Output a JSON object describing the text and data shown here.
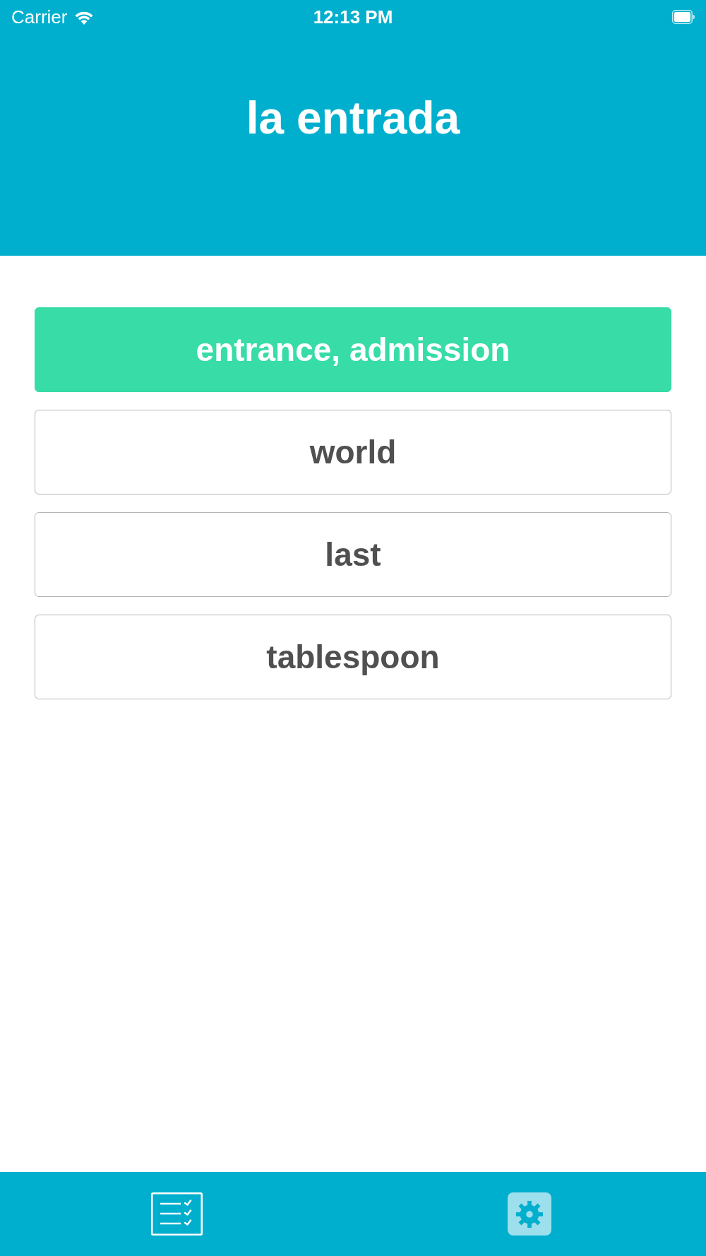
{
  "status_bar": {
    "carrier": "Carrier",
    "time": "12:13 PM"
  },
  "header": {
    "title": "la entrada"
  },
  "answers": [
    {
      "text": "entrance, admission",
      "correct": true
    },
    {
      "text": "world",
      "correct": false
    },
    {
      "text": "last",
      "correct": false
    },
    {
      "text": "tablespoon",
      "correct": false
    }
  ],
  "tab_bar": {
    "items": [
      {
        "kind": "list",
        "selected": false
      },
      {
        "kind": "settings",
        "selected": true
      }
    ]
  }
}
